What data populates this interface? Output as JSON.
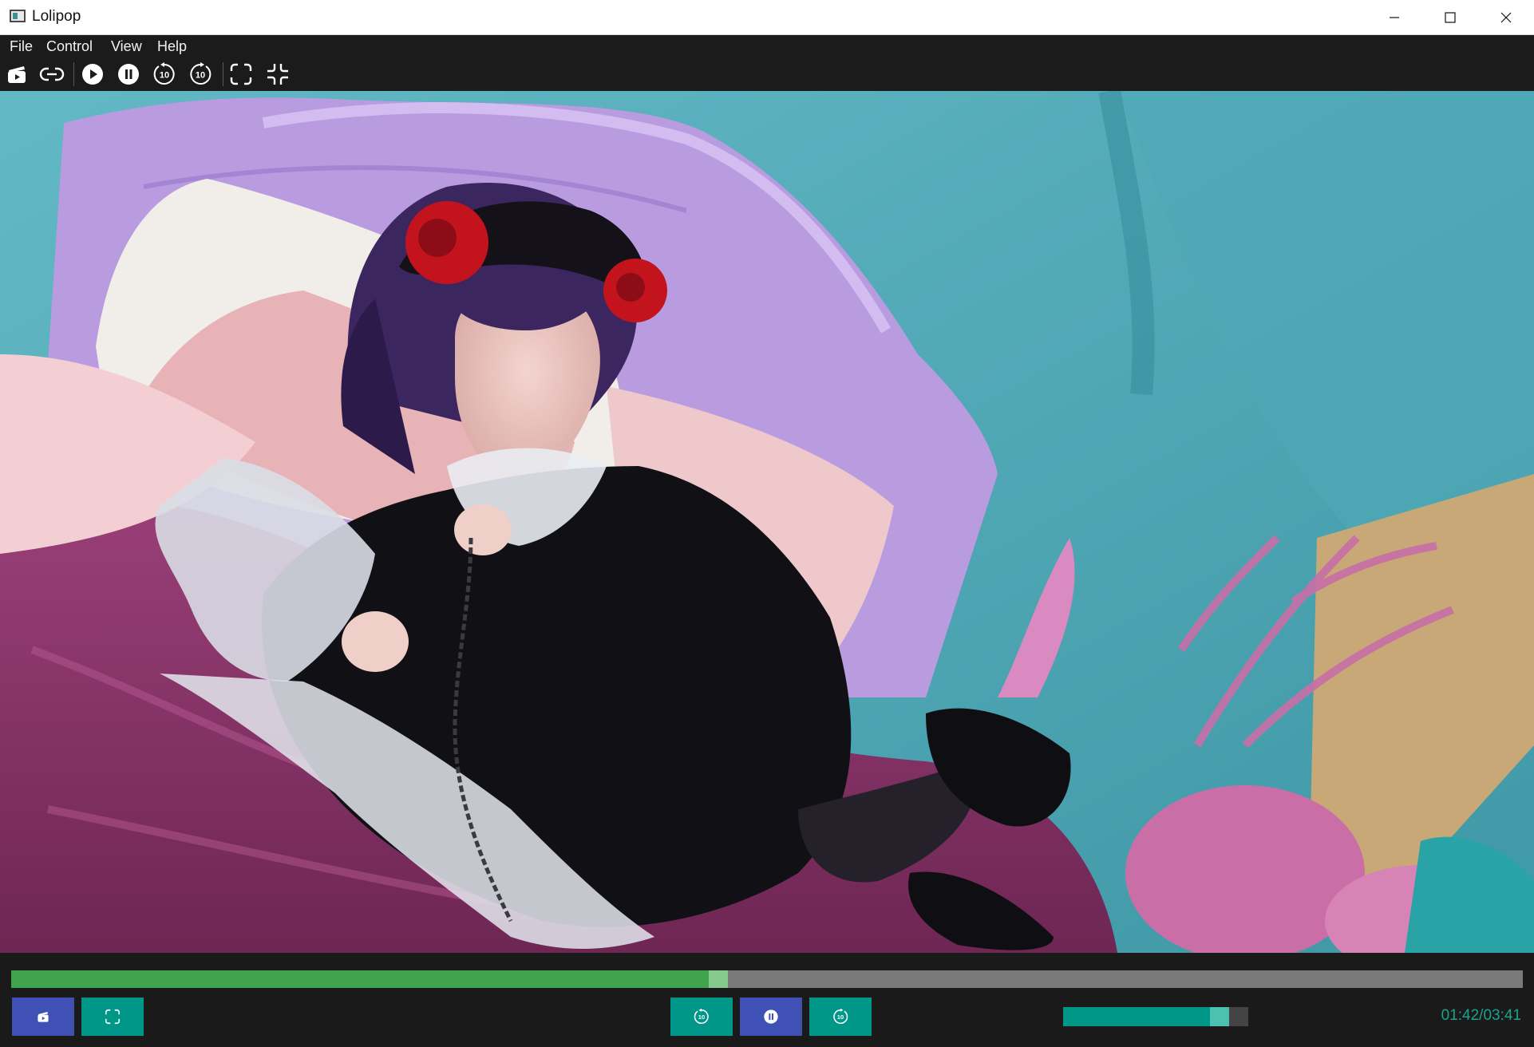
{
  "window": {
    "title": "Lolipop",
    "app_icon": "app-window-icon"
  },
  "menu": [
    "File",
    "Control",
    "View",
    "Help"
  ],
  "toolbar": [
    {
      "name": "open-file-icon"
    },
    {
      "name": "open-url-icon"
    },
    {
      "name": "play-icon"
    },
    {
      "name": "pause-icon"
    },
    {
      "name": "rewind-10-icon"
    },
    {
      "name": "forward-10-icon"
    },
    {
      "name": "fullscreen-icon"
    },
    {
      "name": "exit-fullscreen-icon"
    }
  ],
  "player": {
    "progress_fraction": 0.4615,
    "volume_fraction": 0.8,
    "time_display": "01:42/03:41"
  },
  "colors": {
    "progress_played": "#3fa34d",
    "progress_track": "#7a7a7a",
    "button_blue": "#3f51b5",
    "button_teal": "#009688",
    "time_text": "#17a58e"
  },
  "controls": [
    {
      "name": "open-file-button",
      "icon": "open-file-icon"
    },
    {
      "name": "fullscreen-button",
      "icon": "fullscreen-icon"
    },
    {
      "name": "rewind-button",
      "icon": "rewind-10-icon"
    },
    {
      "name": "pause-button",
      "icon": "pause-icon"
    },
    {
      "name": "forward-button",
      "icon": "forward-10-icon"
    }
  ]
}
